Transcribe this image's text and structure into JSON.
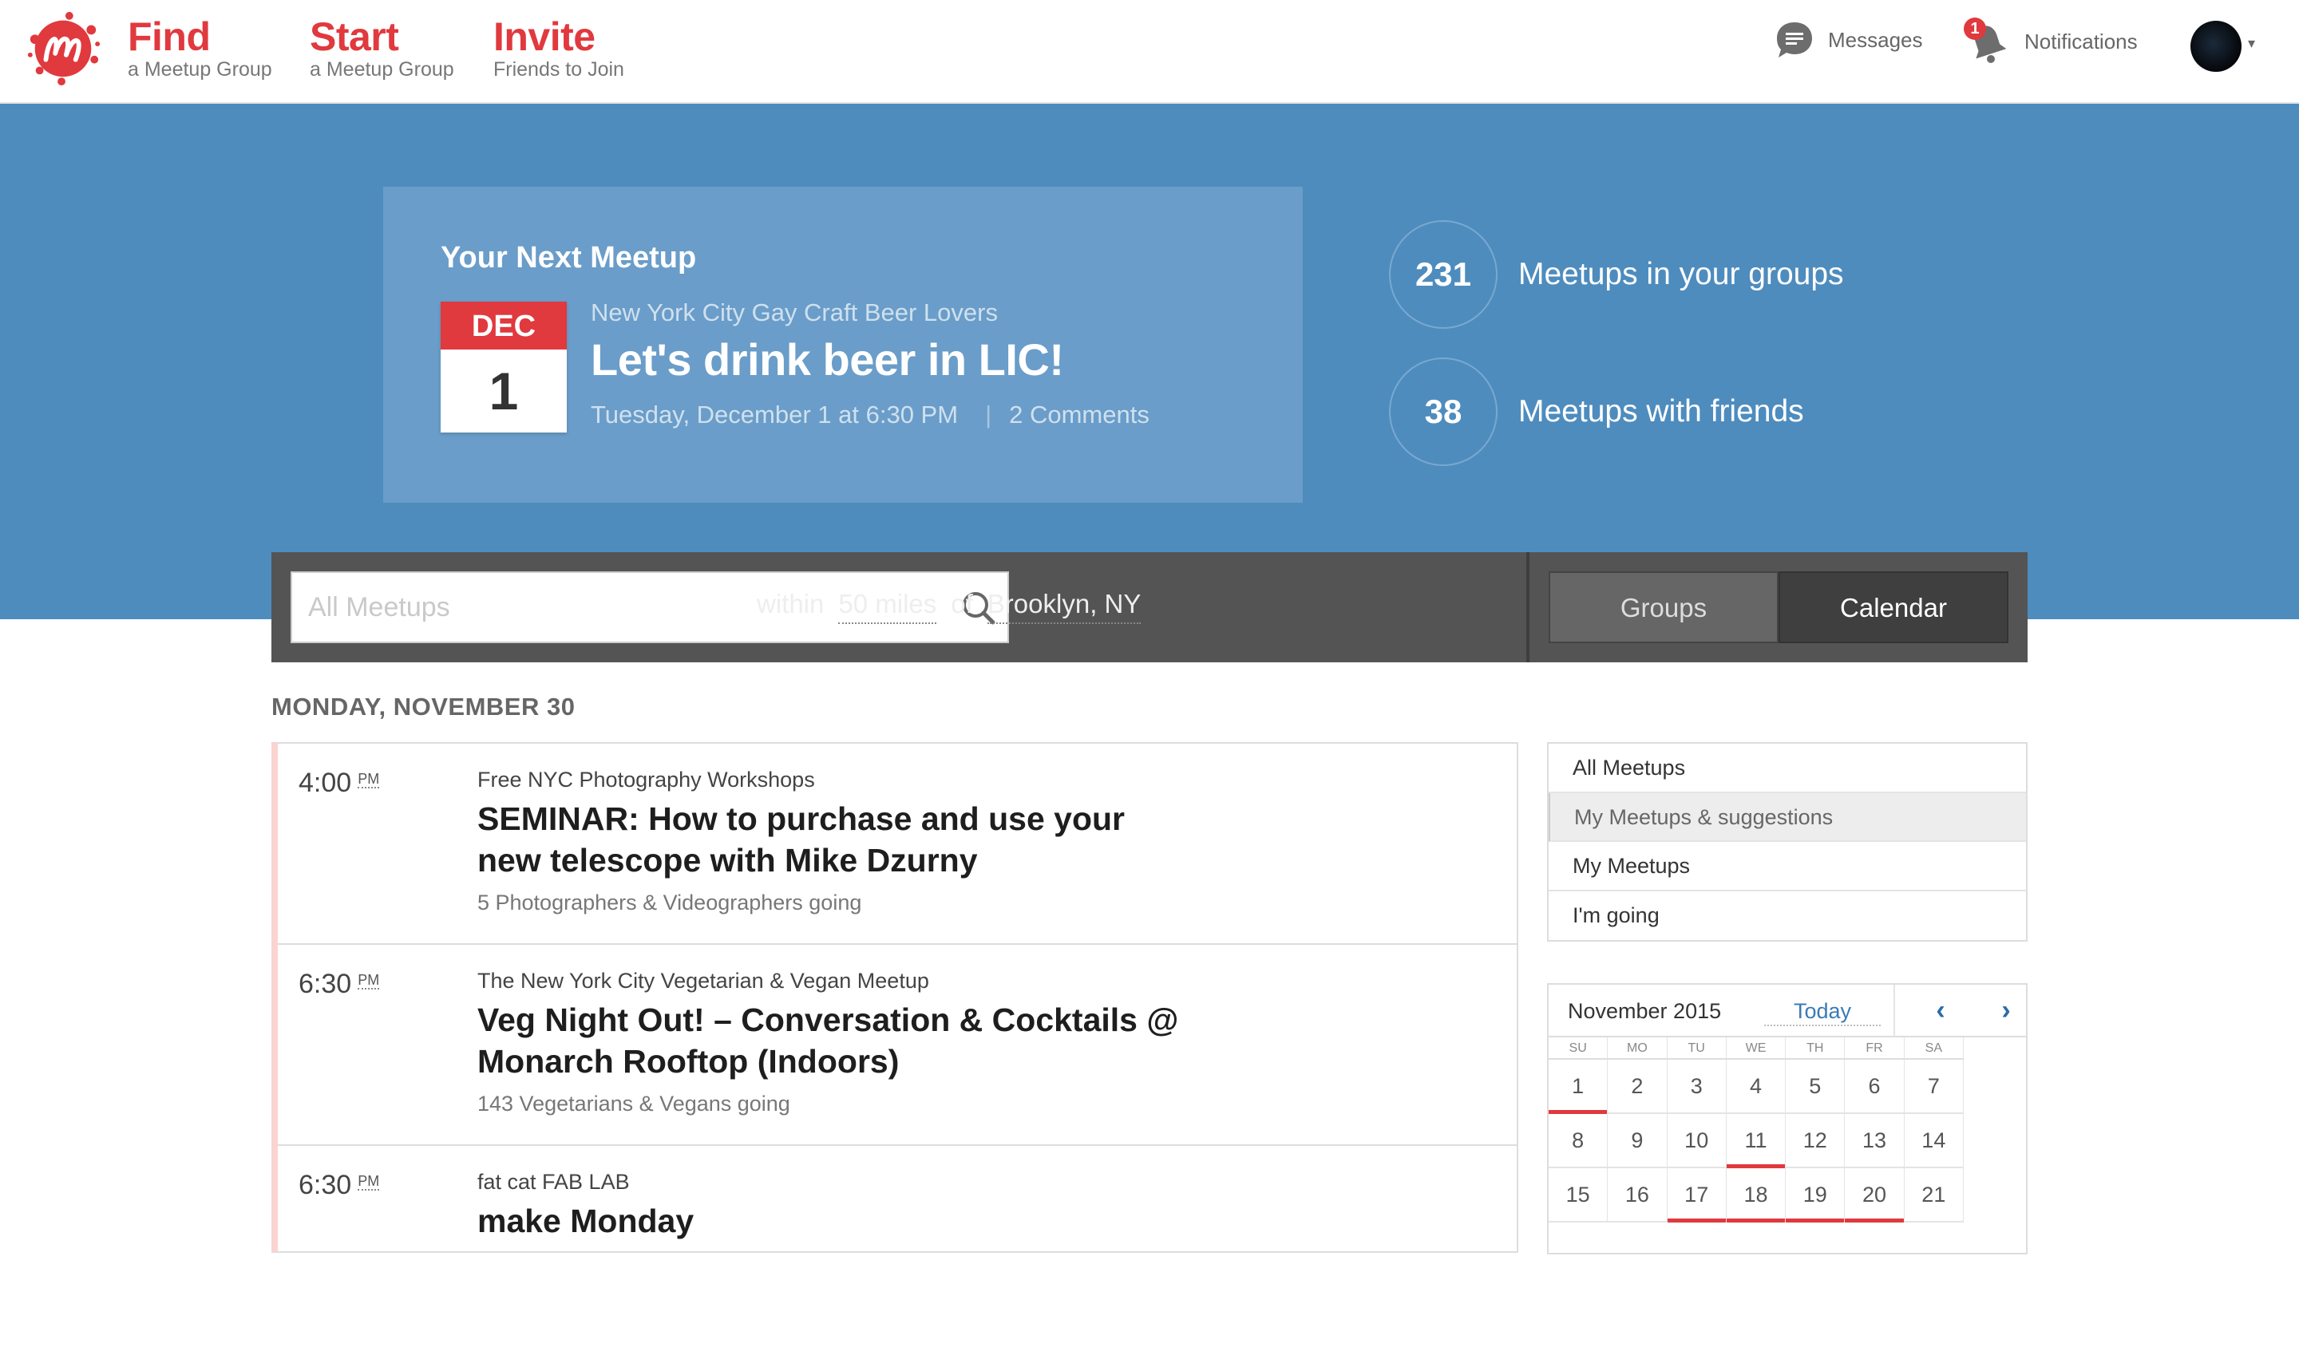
{
  "nav": {
    "find": {
      "big": "Find",
      "small": "a Meetup Group"
    },
    "start": {
      "big": "Start",
      "small": "a Meetup Group"
    },
    "invite": {
      "big": "Invite",
      "small": "Friends to Join"
    },
    "messages_label": "Messages",
    "notifications_label": "Notifications",
    "notifications_count": "1"
  },
  "hero": {
    "heading": "Your Next Meetup",
    "cal_month": "DEC",
    "cal_day": "1",
    "group": "New York City Gay Craft Beer Lovers",
    "title": "Let's drink beer in LIC!",
    "when": "Tuesday, December 1 at 6:30 PM",
    "separator": "|",
    "comments": "2 Comments",
    "stats": [
      {
        "count": "231",
        "label": "Meetups in your groups"
      },
      {
        "count": "38",
        "label": "Meetups with friends"
      }
    ]
  },
  "search": {
    "placeholder": "All Meetups",
    "within": "within",
    "distance": "50 miles",
    "of": "of",
    "location": "Brooklyn, NY",
    "groups_label": "Groups",
    "calendar_label": "Calendar"
  },
  "list": {
    "day_heading": "MONDAY, NOVEMBER 30",
    "events": [
      {
        "time": "4:00",
        "ampm": "PM",
        "group": "Free NYC Photography Workshops",
        "title": "SEMINAR: How to purchase and use your new telescope with Mike Dzurny",
        "going": "5 Photographers & Videographers going"
      },
      {
        "time": "6:30",
        "ampm": "PM",
        "group": "The New York City Vegetarian & Vegan Meetup",
        "title": "Veg Night Out! – Conversation & Cocktails @ Monarch Rooftop (Indoors)",
        "going": "143 Vegetarians & Vegans going"
      },
      {
        "time": "6:30",
        "ampm": "PM",
        "group": "fat cat FAB LAB",
        "title": "make Monday",
        "going": ""
      }
    ]
  },
  "filters": [
    {
      "label": "All Meetups"
    },
    {
      "label": "My Meetups & suggestions"
    },
    {
      "label": "My Meetups"
    },
    {
      "label": "I'm going"
    }
  ],
  "calendar": {
    "month": "November 2015",
    "today_label": "Today",
    "prev_icon": "‹",
    "next_icon": "›",
    "dow": [
      "SU",
      "MO",
      "TU",
      "WE",
      "TH",
      "FR",
      "SA"
    ],
    "weeks": [
      [
        "1",
        "2",
        "3",
        "4",
        "5",
        "6",
        "7"
      ],
      [
        "8",
        "9",
        "10",
        "11",
        "12",
        "13",
        "14"
      ],
      [
        "15",
        "16",
        "17",
        "18",
        "19",
        "20",
        "21"
      ]
    ]
  },
  "colors": {
    "brand_red": "#e0393e",
    "hero_blue": "#4e8cbe",
    "card_blue": "#6a9dc9",
    "bar_gray": "#545454"
  }
}
